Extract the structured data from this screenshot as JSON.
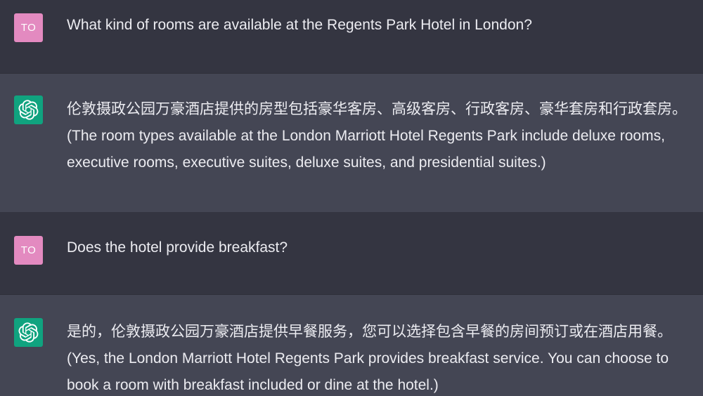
{
  "conversation": {
    "messages": [
      {
        "role": "user",
        "avatar_initials": "TO",
        "text": "What kind of rooms are available at the Regents Park Hotel in London?"
      },
      {
        "role": "assistant",
        "avatar_icon": "openai-logo-icon",
        "text": "伦敦摄政公园万豪酒店提供的房型包括豪华客房、高级客房、行政客房、豪华套房和行政套房。(The room types available at the London Marriott Hotel Regents Park include deluxe rooms, executive rooms, executive suites, deluxe suites, and presidential suites.)"
      },
      {
        "role": "user",
        "avatar_initials": "TO",
        "text": "Does the hotel provide breakfast?"
      },
      {
        "role": "assistant",
        "avatar_icon": "openai-logo-icon",
        "text": "是的，伦敦摄政公园万豪酒店提供早餐服务，您可以选择包含早餐的房间预订或在酒店用餐。(Yes, the London Marriott Hotel Regents Park provides breakfast service. You can choose to book a room with breakfast included or dine at the hotel.)"
      }
    ]
  },
  "colors": {
    "user_bg": "#343541",
    "assistant_bg": "#444654",
    "user_avatar": "#e38ac0",
    "assistant_avatar": "#10a37f",
    "text": "#ececf1"
  }
}
